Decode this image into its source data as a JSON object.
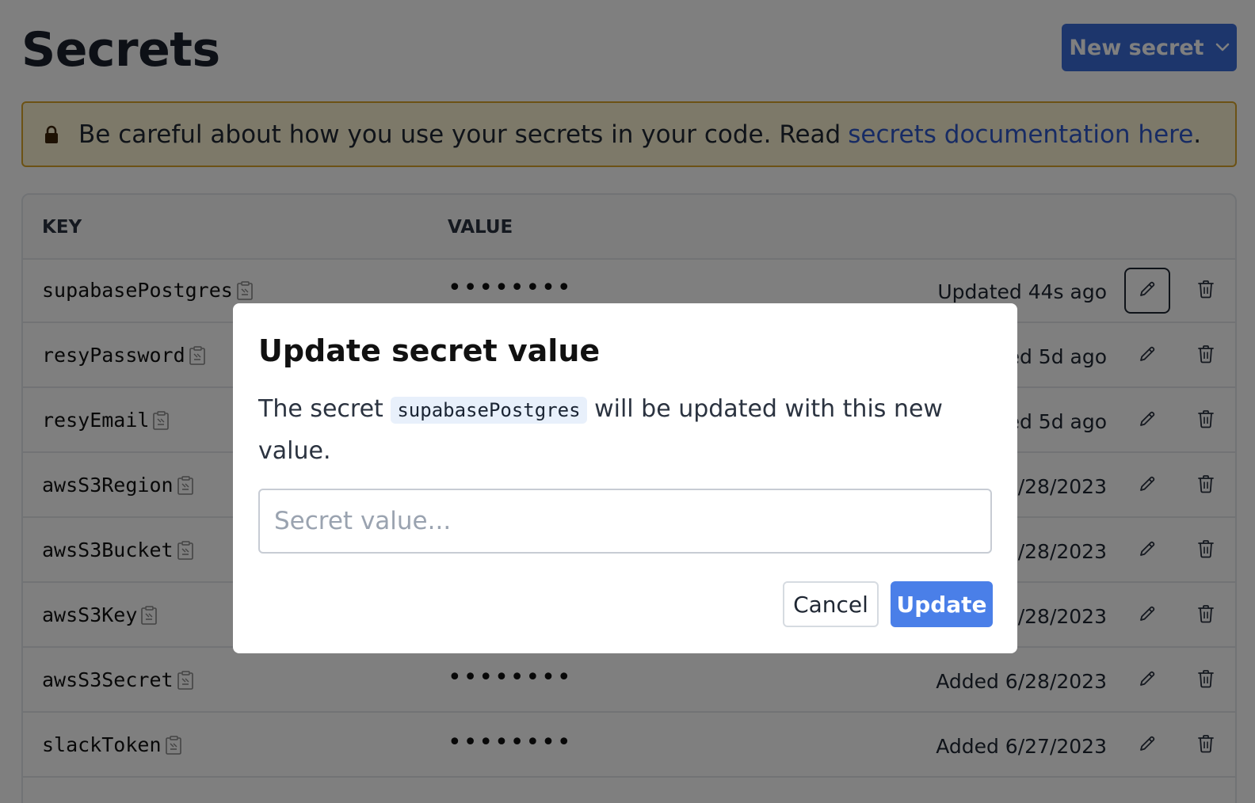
{
  "page": {
    "title": "Secrets"
  },
  "toolbar": {
    "new_secret_label": "New secret"
  },
  "warning": {
    "text": "Be careful about how you use your secrets in your code. Read",
    "link_text": "secrets documentation here",
    "suffix": "."
  },
  "table": {
    "headers": {
      "key": "KEY",
      "value": "VALUE"
    },
    "rows": [
      {
        "key": "supabasePostgres",
        "value": "••••••••",
        "status": "Updated 44s ago"
      },
      {
        "key": "resyPassword",
        "value": "••••••••",
        "status": "Updated 5d ago"
      },
      {
        "key": "resyEmail",
        "value": "••••••••",
        "status": "Updated 5d ago"
      },
      {
        "key": "awsS3Region",
        "value": "••••••••",
        "status": "Added 6/28/2023"
      },
      {
        "key": "awsS3Bucket",
        "value": "••••••••",
        "status": "Added 6/28/2023"
      },
      {
        "key": "awsS3Key",
        "value": "••••••••",
        "status": "Added 6/28/2023"
      },
      {
        "key": "awsS3Secret",
        "value": "••••••••",
        "status": "Added 6/28/2023"
      },
      {
        "key": "slackToken",
        "value": "••••••••",
        "status": "Added 6/27/2023"
      }
    ]
  },
  "modal": {
    "title": "Update secret value",
    "desc_before": "The secret",
    "secret_name": "supabasePostgres",
    "desc_after": "will be updated with this new value.",
    "input_value": "",
    "input_placeholder": "Secret value...",
    "cancel_label": "Cancel",
    "update_label": "Update"
  },
  "colors": {
    "primary": "#3b6cd9",
    "update": "#4a7fe8",
    "warning_bg": "#fbf2d3",
    "warning_border": "#d8a52a",
    "link": "#2f57c8"
  },
  "icons": {
    "new_secret": "chevron-down-icon",
    "warning": "lock-icon",
    "copy": "copy-icon",
    "edit": "pencil-icon",
    "delete": "trash-icon"
  }
}
